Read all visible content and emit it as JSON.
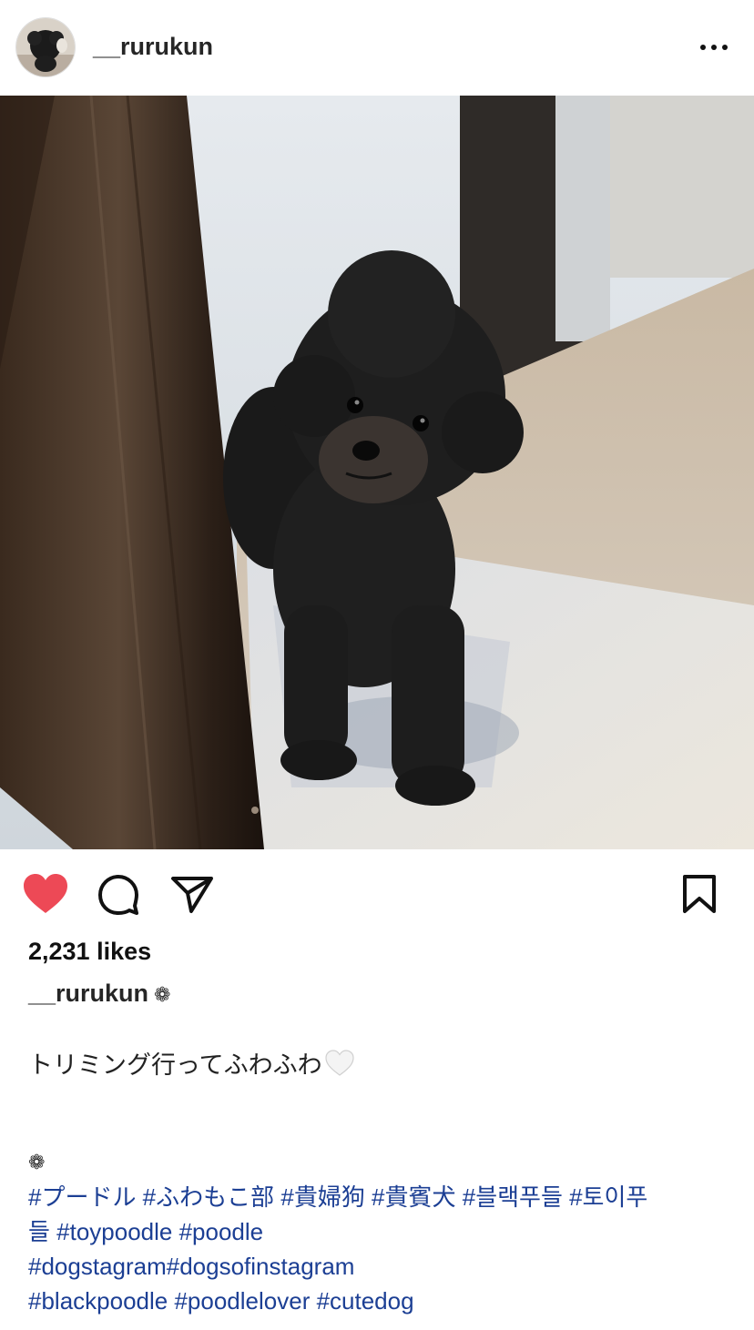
{
  "post": {
    "username": "__rurukun",
    "more_icon": "more-horizontal-icon"
  },
  "actions": {
    "like_icon": "heart-filled-icon",
    "comment_icon": "comment-icon",
    "share_icon": "send-icon",
    "save_icon": "bookmark-icon",
    "like_color": "#ed4956"
  },
  "likes_text": "2,231 likes",
  "caption": {
    "author": "__rurukun",
    "author_symbol": "❁",
    "text": "トリミング行ってふわふわ",
    "text_emoji": "white-heart-icon",
    "symbol_line": "❁",
    "hashtag_lines": [
      "#プードル  #ふわもこ部 #貴婦狗 #貴賓犬 #블랙푸들 #토이푸",
      "들 #toypoodle #poodle",
      "#dogstagram#dogsofinstagram",
      "#blackpoodle #poodlelover #cutedog"
    ]
  },
  "colors": {
    "hashtag": "#1c3f94",
    "text": "#262626"
  }
}
